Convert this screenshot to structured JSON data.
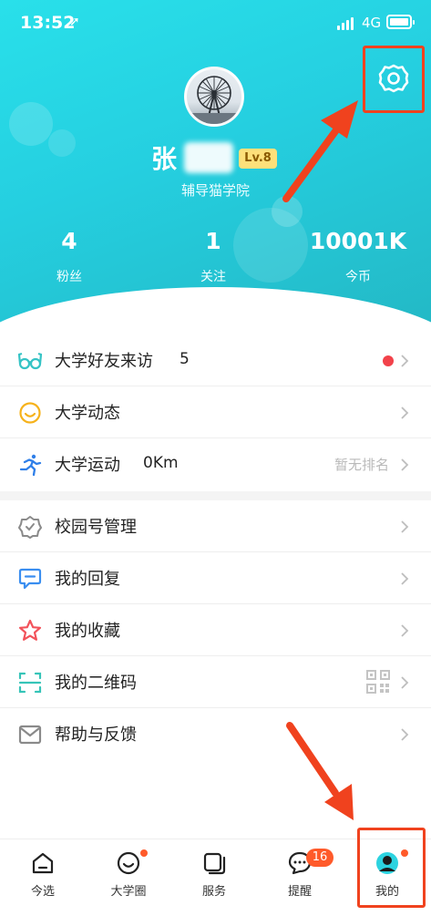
{
  "status_bar": {
    "time": "13:52",
    "location_glyph": "➚",
    "network": "4G"
  },
  "profile": {
    "name": "张",
    "level": "Lv.8",
    "school": "辅导猫学院",
    "stats": [
      {
        "value": "4",
        "label": "粉丝"
      },
      {
        "value": "1",
        "label": "关注"
      },
      {
        "value": "10001K",
        "label": "今币"
      }
    ]
  },
  "menu_group_1": [
    {
      "label": "大学好友来访",
      "value": "5",
      "icon": "glasses-icon",
      "has_red_dot": true
    },
    {
      "label": "大学动态",
      "icon": "smile-icon"
    },
    {
      "label": "大学运动",
      "value": "0Km",
      "aside": "暂无排名",
      "icon": "runner-icon"
    }
  ],
  "menu_group_2": [
    {
      "label": "校园号管理",
      "icon": "badge-icon"
    },
    {
      "label": "我的回复",
      "icon": "chat-bubble-icon"
    },
    {
      "label": "我的收藏",
      "icon": "star-icon"
    },
    {
      "label": "我的二维码",
      "icon": "scan-icon",
      "aside_icon": "qr-code-icon"
    },
    {
      "label": "帮助与反馈",
      "icon": "mail-icon"
    }
  ],
  "tabbar": {
    "items": [
      {
        "label": "今选",
        "icon": "home-icon"
      },
      {
        "label": "大学圈",
        "icon": "smile-circle-icon",
        "dot": true
      },
      {
        "label": "服务",
        "icon": "cards-icon"
      },
      {
        "label": "提醒",
        "icon": "message-icon",
        "badge": "16"
      },
      {
        "label": "我的",
        "icon": "profile-icon",
        "dot": true,
        "active": true
      }
    ]
  },
  "colors": {
    "header_gradient_start": "#29e0ea",
    "header_gradient_end": "#23b9c6",
    "highlight_red": "#f0421e",
    "badge_orange": "#ff5a2a",
    "level_badge_bg": "#fde07a"
  }
}
